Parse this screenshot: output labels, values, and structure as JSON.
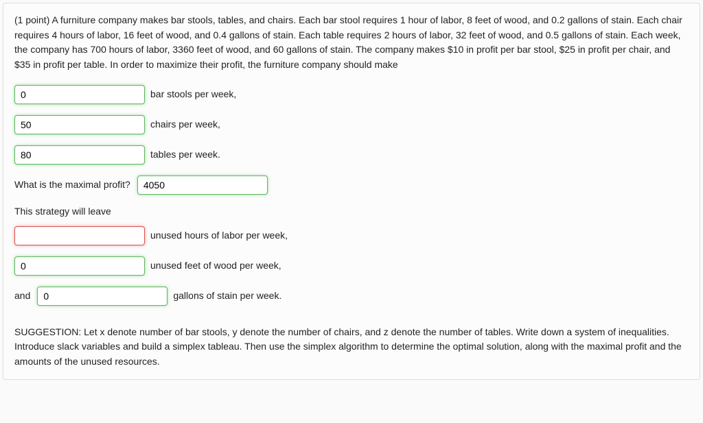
{
  "stem": "(1 point) A furniture company makes bar stools, tables, and chairs. Each bar stool requires 1 hour of labor, 8 feet of wood, and 0.2 gallons of stain. Each chair requires 4 hours of labor, 16 feet of wood, and 0.4 gallons of stain. Each table requires 2 hours of labor, 32 feet of wood, and 0.5 gallons of stain. Each week, the company has 700 hours of labor, 3360 feet of wood, and 60 gallons of stain. The company makes $10 in profit per bar stool, $25 in profit per chair, and $35 in profit per table. In order to maximize their profit, the furniture company should make",
  "fields": {
    "bar_stools": {
      "value": "0",
      "label": "bar stools per week,"
    },
    "chairs": {
      "value": "50",
      "label": "chairs per week,"
    },
    "tables": {
      "value": "80",
      "label": "tables per week."
    },
    "profit": {
      "lead": "What is the maximal profit?",
      "value": "4050"
    },
    "leave_text": "This strategy will leave",
    "labor": {
      "value": "",
      "label": "unused hours of labor per week,"
    },
    "wood": {
      "value": "0",
      "label": "unused feet of wood per week,"
    },
    "stain": {
      "lead": "and",
      "value": "0",
      "label": "gallons of stain per week."
    }
  },
  "suggestion": "SUGGESTION: Let x denote number of bar stools, y denote the number of chairs, and z denote the number of tables. Write down a system of inequalities. Introduce slack variables and build a simplex tableau. Then use the simplex algorithm to determine the optimal solution, along with the maximal profit and the amounts of the unused resources."
}
